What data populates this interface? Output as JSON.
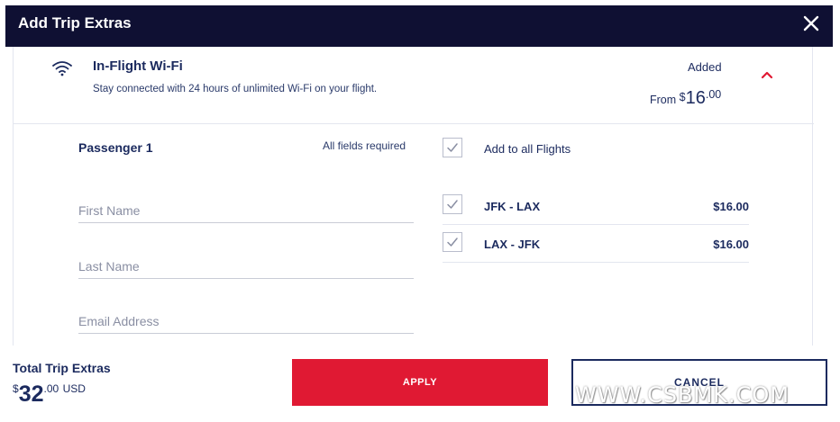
{
  "modal": {
    "title": "Add Trip Extras",
    "close_icon": "close-icon",
    "colors": {
      "header_bg": "#0f1033",
      "accent_red": "#e01933",
      "navy": "#1b2a5e"
    }
  },
  "product": {
    "icon": "wifi-icon",
    "name": "In-Flight Wi-Fi",
    "description": "Stay connected with 24 hours of unlimited Wi-Fi on your flight.",
    "status": "Added",
    "price_prefix": "From",
    "price_currency": "$",
    "price_dollars": "16",
    "price_cents": ".00",
    "toggle_icon": "chevron-up-icon"
  },
  "passenger": {
    "title": "Passenger 1",
    "fields_required": "All fields required",
    "first_name": {
      "placeholder": "First Name",
      "value": ""
    },
    "last_name": {
      "placeholder": "Last Name",
      "value": ""
    },
    "email": {
      "placeholder": "Email Address",
      "value": ""
    }
  },
  "flights": {
    "add_all": {
      "label": "Add to all Flights",
      "checked": true
    },
    "items": [
      {
        "route": "JFK - LAX",
        "price": "$16.00",
        "checked": true
      },
      {
        "route": "LAX - JFK",
        "price": "$16.00",
        "checked": true
      }
    ]
  },
  "footer": {
    "total_label": "Total Trip Extras",
    "total_currency": "$",
    "total_dollars": "32",
    "total_cents": ".00",
    "total_unit": "USD",
    "apply_label": "APPLY",
    "cancel_label": "CANCEL",
    "watermark": "WWW.CSBMK.COM"
  }
}
